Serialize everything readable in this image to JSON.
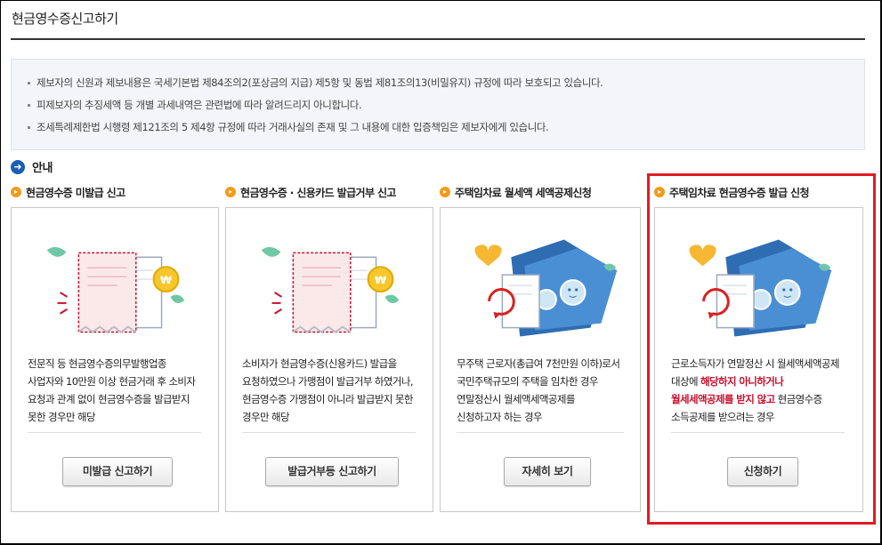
{
  "page": {
    "title": "현금영수증신고하기"
  },
  "notice": {
    "items": [
      "제보자의 신원과 제보내용은 국세기본법 제84조의2(포상금의 지급) 제5항 및 동법 제81조의13(비밀유지) 규정에 따라 보호되고 있습니다.",
      "피제보자의 추징세액 등 개별 과세내역은 관련법에 따라 알려드리지 아니합니다.",
      "조세특례제한법 시행령 제121조의 5 제4항 규정에 따라 거래사실의 존재 및 그 내용에 대한 입증책임은 제보자에게 있습니다."
    ]
  },
  "section": {
    "title": "안내"
  },
  "cards": [
    {
      "title": "현금영수증 미발급 신고",
      "text": "전문직 등 현금영수증의무발행업종 사업자와 10만원 이상 현금거래 후 소비자 요청과 관계 없이 현금영수증을 발급받지 못한 경우만 해당",
      "button": "미발급 신고하기"
    },
    {
      "title": "현금영수증 · 신용카드 발급거부 신고",
      "text": "소비자가 현금영수증(신용카드) 발급을 요청하였으나 가맹점이 발급거부 하였거나, 현금영수증 가맹점이 아니라 발급받지 못한 경우만 해당",
      "button": "발급거부등 신고하기"
    },
    {
      "title": "주택임차료 월세액 세액공제신청",
      "text": "무주택 근로자(총급여 7천만원 이하)로서 국민주택규모의 주택을 임차한 경우 연말정산시 월세액세액공제를 신청하고자 하는 경우",
      "button": "자세히 보기"
    },
    {
      "title": "주택임차료 현금영수증 발급 신청",
      "text_before": "근로소득자가 연말정산 시 월세액세액공제 대상에 ",
      "text_highlight": "해당하지 아니하거나 월세세액공제를 받지 않고",
      "text_after": " 현금영수증 소득공제를 받으려는 경우",
      "button": "신청하기"
    }
  ],
  "icons": {
    "section_icon": "arrow-right-circle-icon",
    "col_bullet": "chevron-right-circle-icon",
    "illus_1": "receipt-coin-illustration",
    "illus_2": "receipt-coin-illustration",
    "illus_3": "house-card-receipt-illustration",
    "illus_4": "house-card-receipt-illustration"
  },
  "colors": {
    "accent_blue": "#1a5fb4",
    "bullet_orange": "#f39a1a",
    "highlight_red": "#e01b24",
    "notice_bg": "#f3f5fa"
  }
}
